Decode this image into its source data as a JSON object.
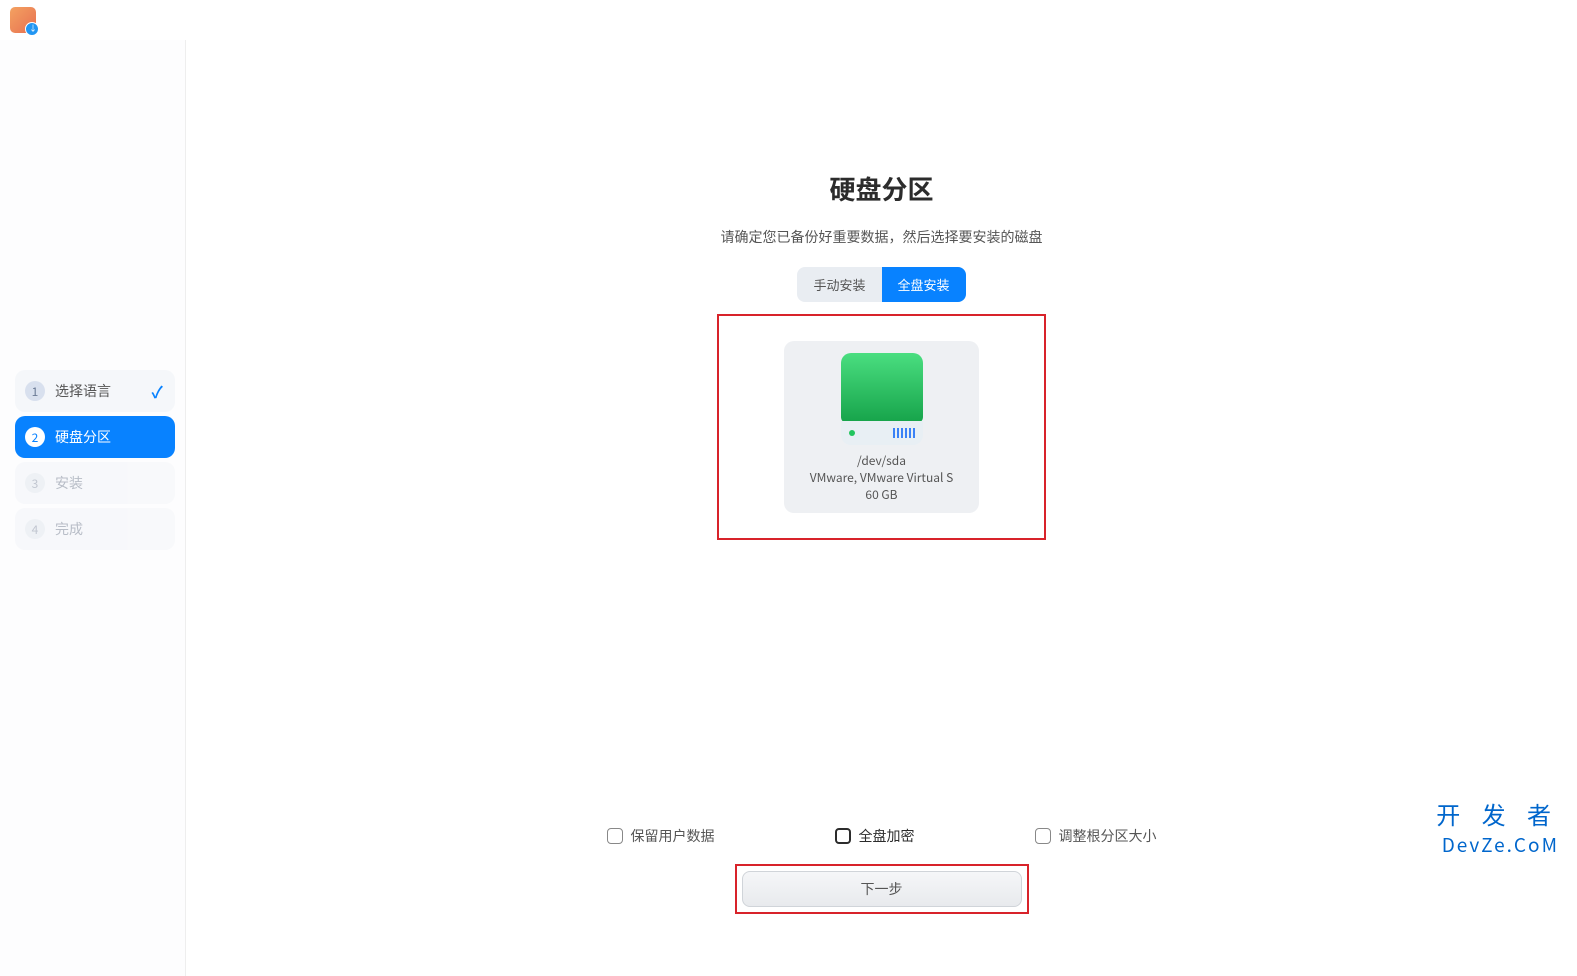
{
  "sidebar": {
    "steps": [
      {
        "num": "1",
        "label": "选择语言",
        "state": "completed"
      },
      {
        "num": "2",
        "label": "硬盘分区",
        "state": "active"
      },
      {
        "num": "3",
        "label": "安装",
        "state": "pending"
      },
      {
        "num": "4",
        "label": "完成",
        "state": "pending"
      }
    ]
  },
  "page": {
    "title": "硬盘分区",
    "subtitle": "请确定您已备份好重要数据，然后选择要安装的磁盘"
  },
  "tabs": {
    "manual": "手动安装",
    "full": "全盘安装"
  },
  "disk": {
    "path": "/dev/sda",
    "description": "VMware, VMware Virtual S",
    "size": "60 GB"
  },
  "options": {
    "keep_user_data": "保留用户数据",
    "full_disk_encryption": "全盘加密",
    "resize_root": "调整根分区大小"
  },
  "buttons": {
    "next": "下一步"
  },
  "watermark": {
    "cn": "开 发 者",
    "en": "DevZe.CoM"
  }
}
